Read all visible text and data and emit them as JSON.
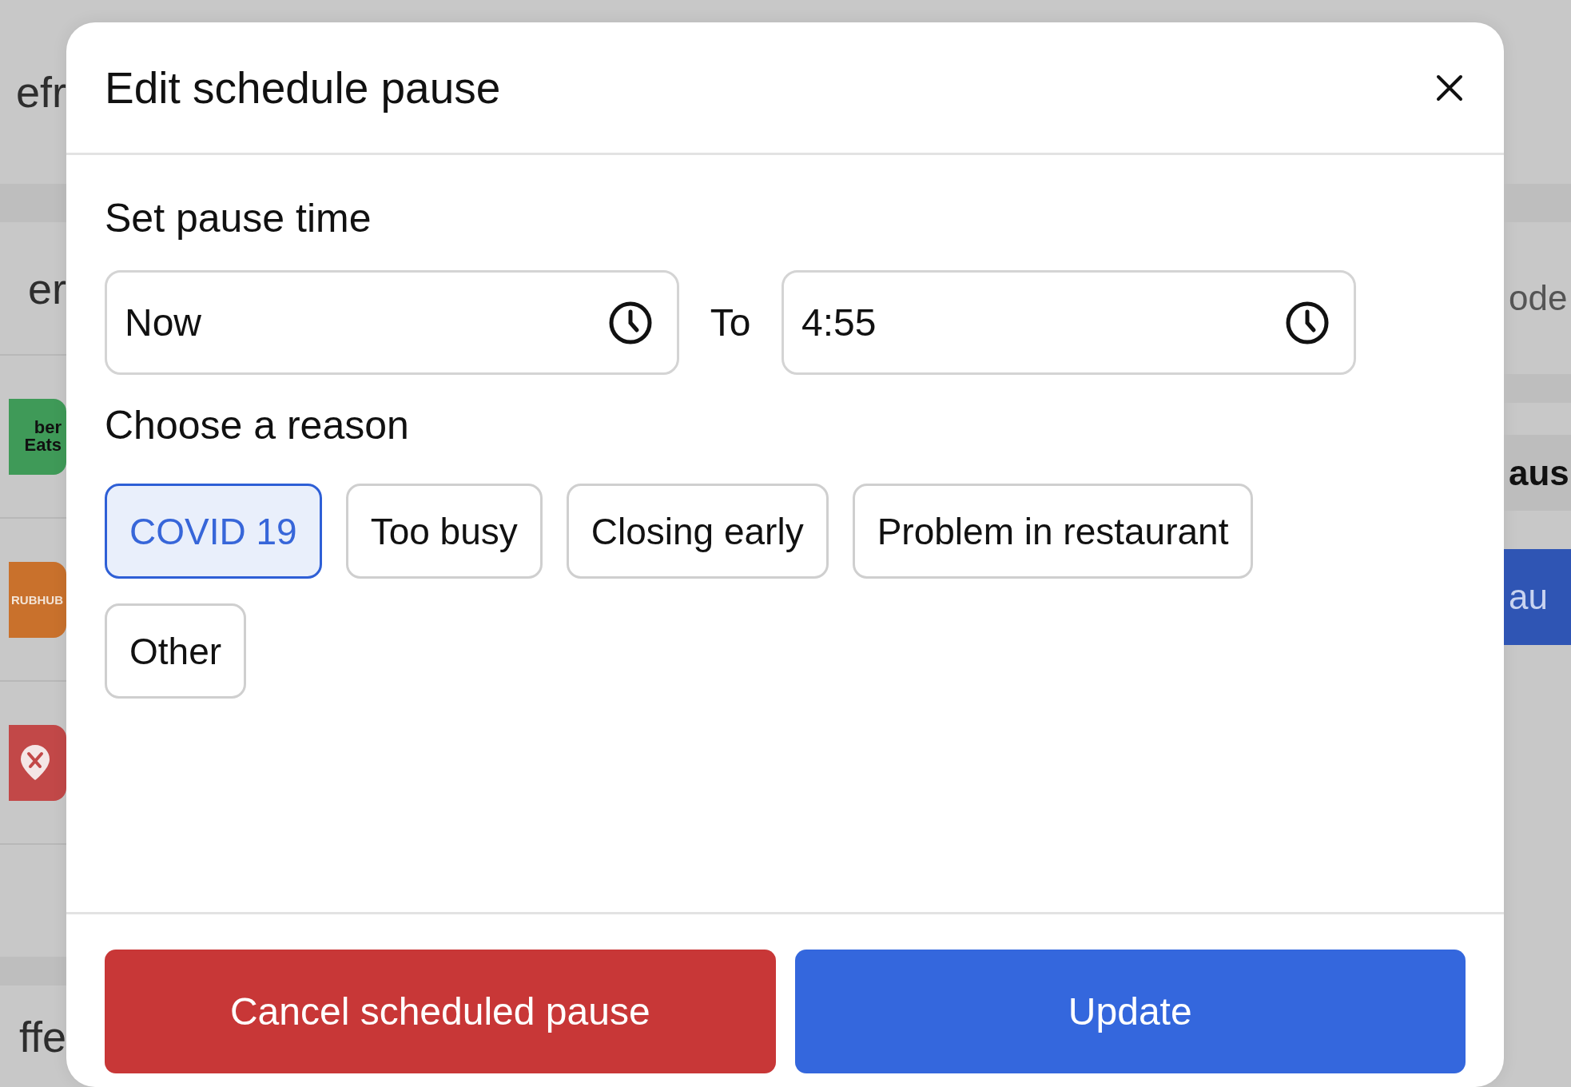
{
  "background": {
    "left": {
      "heading": "efr",
      "row_label": "er",
      "logos": [
        {
          "kind": "ubereats",
          "lines": [
            "ber",
            "Eats"
          ]
        },
        {
          "kind": "grubhub",
          "lines": [
            "RUBHUB"
          ]
        },
        {
          "kind": "pin"
        }
      ],
      "footer": "ffe"
    },
    "right": {
      "label": "ode",
      "heading": "aus",
      "button": "au"
    }
  },
  "modal": {
    "title": "Edit schedule pause",
    "pause_time": {
      "label": "Set pause time",
      "from": {
        "value": "Now"
      },
      "separator": "To",
      "to": {
        "value": "4:55"
      }
    },
    "reason": {
      "label": "Choose a reason",
      "options": [
        {
          "label": "COVID 19",
          "selected": true
        },
        {
          "label": "Too busy",
          "selected": false
        },
        {
          "label": "Closing early",
          "selected": false
        },
        {
          "label": "Problem in restaurant",
          "selected": false
        },
        {
          "label": "Other",
          "selected": false
        }
      ]
    },
    "buttons": [
      {
        "label": "Cancel scheduled pause",
        "kind": "danger"
      },
      {
        "label": "Update",
        "kind": "primary"
      }
    ]
  }
}
